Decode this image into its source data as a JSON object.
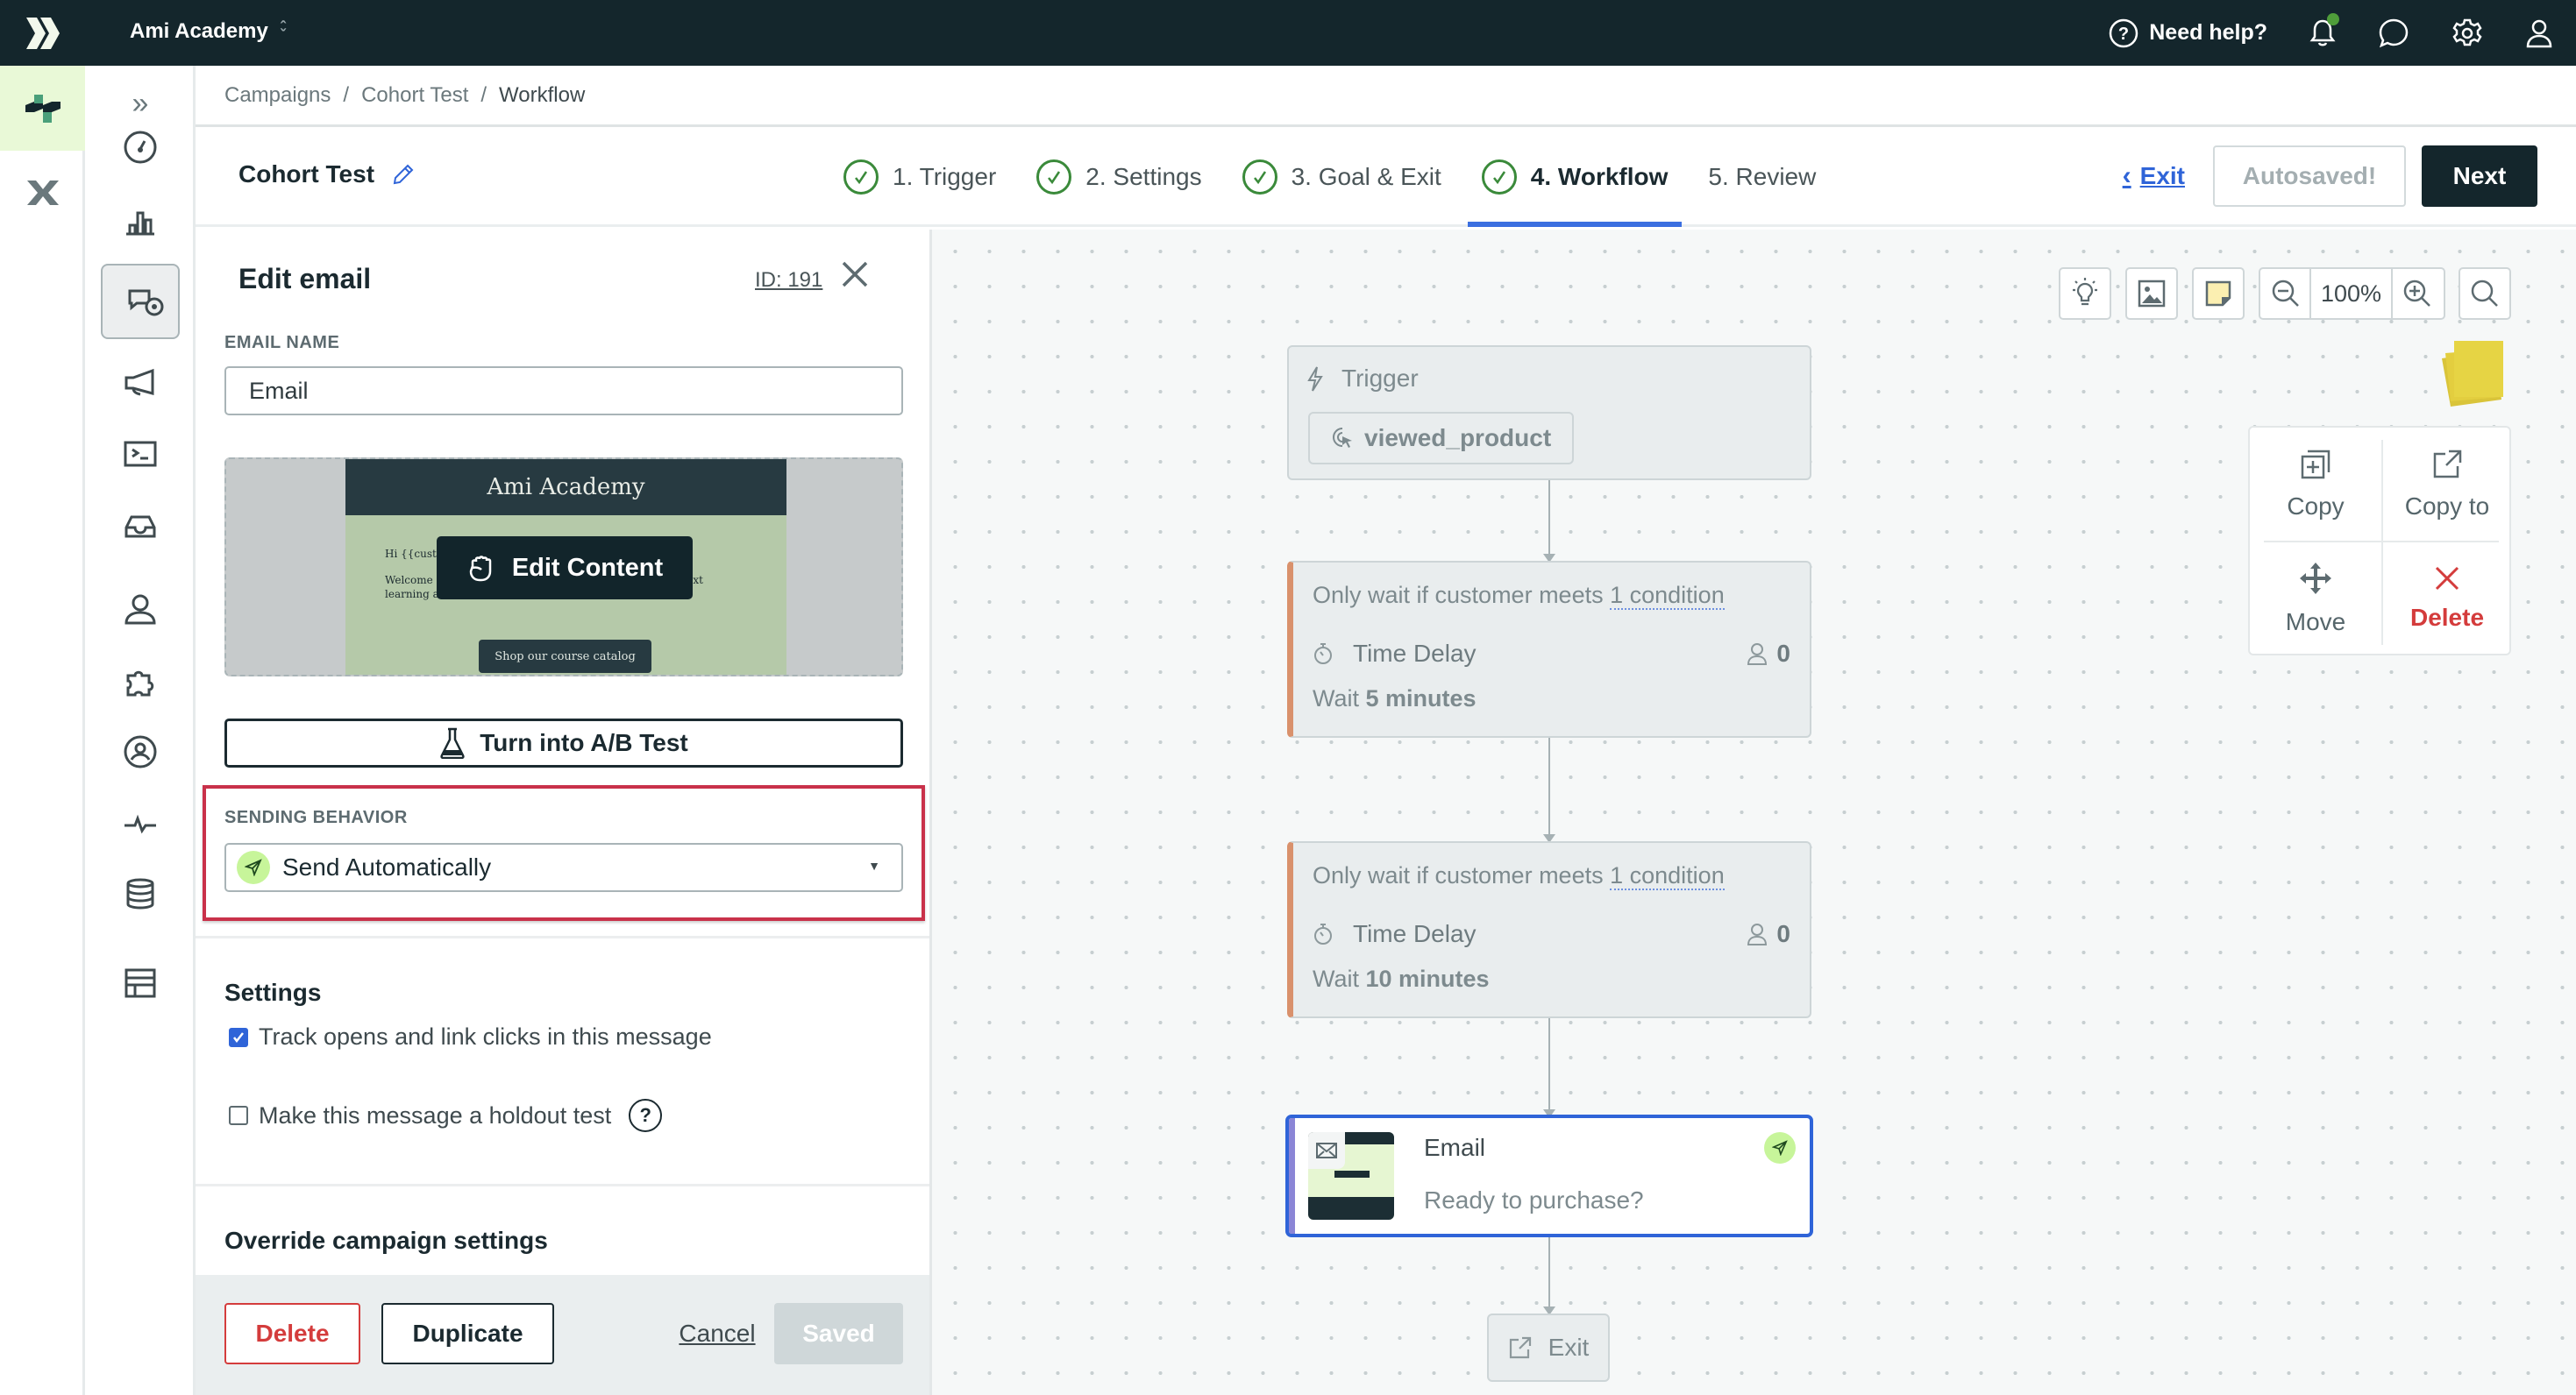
{
  "topbar": {
    "workspace": "Ami Academy",
    "help_label": "Need help?",
    "notification_dot_color": "#4f9d3a"
  },
  "breadcrumb": [
    "Campaigns",
    "Cohort Test",
    "Workflow"
  ],
  "header": {
    "campaign_name": "Cohort Test",
    "steps": [
      {
        "label": "1. Trigger",
        "done": true
      },
      {
        "label": "2. Settings",
        "done": true
      },
      {
        "label": "3. Goal & Exit",
        "done": true
      },
      {
        "label": "4. Workflow",
        "done": true,
        "active": true
      },
      {
        "label": "5. Review",
        "done": false
      }
    ],
    "exit_label": "Exit",
    "autosaved_label": "Autosaved!",
    "next_label": "Next"
  },
  "panel": {
    "title": "Edit email",
    "id_label": "ID: 191",
    "email_name_label": "EMAIL NAME",
    "email_name_value": "Email",
    "preview": {
      "brand": "Ami Academy",
      "greeting": "Hi {{custo",
      "body": "Welcome ... courses or browse our catalog to find your next learning adventure!",
      "cta": "Shop our course catalog",
      "edit_content_label": "Edit Content"
    },
    "ab_test_label": "Turn into A/B Test",
    "sending_behavior_label": "SENDING BEHAVIOR",
    "sending_behavior_value": "Send Automatically",
    "settings_heading": "Settings",
    "track_label": "Track opens and link clicks in this message",
    "track_checked": true,
    "holdout_label": "Make this message a holdout test",
    "holdout_checked": false,
    "override_heading": "Override campaign settings",
    "footer": {
      "delete": "Delete",
      "duplicate": "Duplicate",
      "cancel": "Cancel",
      "saved": "Saved"
    }
  },
  "canvas": {
    "zoom_level": "100%",
    "context_menu": {
      "copy": "Copy",
      "copy_to": "Copy to",
      "move": "Move",
      "delete": "Delete"
    },
    "trigger": {
      "label": "Trigger",
      "event": "viewed_product"
    },
    "delays": [
      {
        "condition_prefix": "Only wait if customer meets ",
        "condition_link": "1 condition",
        "type": "Time Delay",
        "count": "0",
        "wait_prefix": "Wait ",
        "wait_value": "5 minutes"
      },
      {
        "condition_prefix": "Only wait if customer meets ",
        "condition_link": "1 condition",
        "type": "Time Delay",
        "count": "0",
        "wait_prefix": "Wait ",
        "wait_value": "10 minutes"
      }
    ],
    "email_node": {
      "title": "Email",
      "subject": "Ready to purchase?"
    },
    "exit_label": "Exit"
  }
}
